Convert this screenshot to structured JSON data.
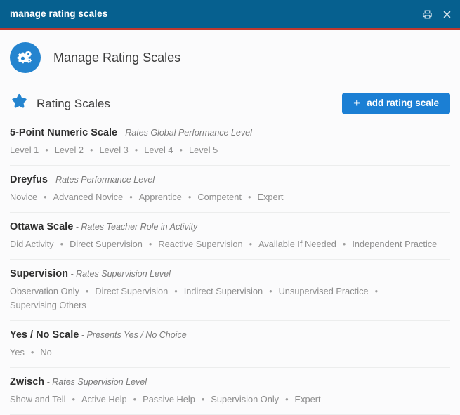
{
  "titlebar": {
    "title": "manage rating scales",
    "print_icon": "printer-icon",
    "close_icon": "close-icon"
  },
  "header": {
    "icon": "cogs-icon",
    "title": "Manage Rating Scales"
  },
  "section": {
    "icon": "star-icon",
    "title": "Rating Scales",
    "add_button_label": "add rating scale",
    "add_button_icon": "plus-icon"
  },
  "colors": {
    "titlebar_blue": "#06608f",
    "accent_red": "#c0392f",
    "badge_blue": "#2484cf",
    "button_blue": "#1b7fd4",
    "star_blue": "#2484cf"
  },
  "separator": "•",
  "scales": [
    {
      "name": "5-Point Numeric Scale",
      "description": "- Rates Global Performance Level",
      "levels": [
        "Level 1",
        "Level 2",
        "Level 3",
        "Level 4",
        "Level 5"
      ]
    },
    {
      "name": "Dreyfus",
      "description": "- Rates Performance Level",
      "levels": [
        "Novice",
        "Advanced Novice",
        "Apprentice",
        "Competent",
        "Expert"
      ]
    },
    {
      "name": "Ottawa Scale",
      "description": "- Rates Teacher Role in Activity",
      "levels": [
        "Did Activity",
        "Direct Supervision",
        "Reactive Supervision",
        "Available If Needed",
        "Independent Practice"
      ]
    },
    {
      "name": "Supervision",
      "description": "- Rates Supervision Level",
      "levels": [
        "Observation Only",
        "Direct Supervision",
        "Indirect Supervision",
        "Unsupervised Practice",
        "Supervising Others"
      ]
    },
    {
      "name": "Yes / No Scale",
      "description": "- Presents Yes / No Choice",
      "levels": [
        "Yes",
        "No"
      ]
    },
    {
      "name": "Zwisch",
      "description": "- Rates Supervision Level",
      "levels": [
        "Show and Tell",
        "Active Help",
        "Passive Help",
        "Supervision Only",
        "Expert"
      ]
    }
  ]
}
